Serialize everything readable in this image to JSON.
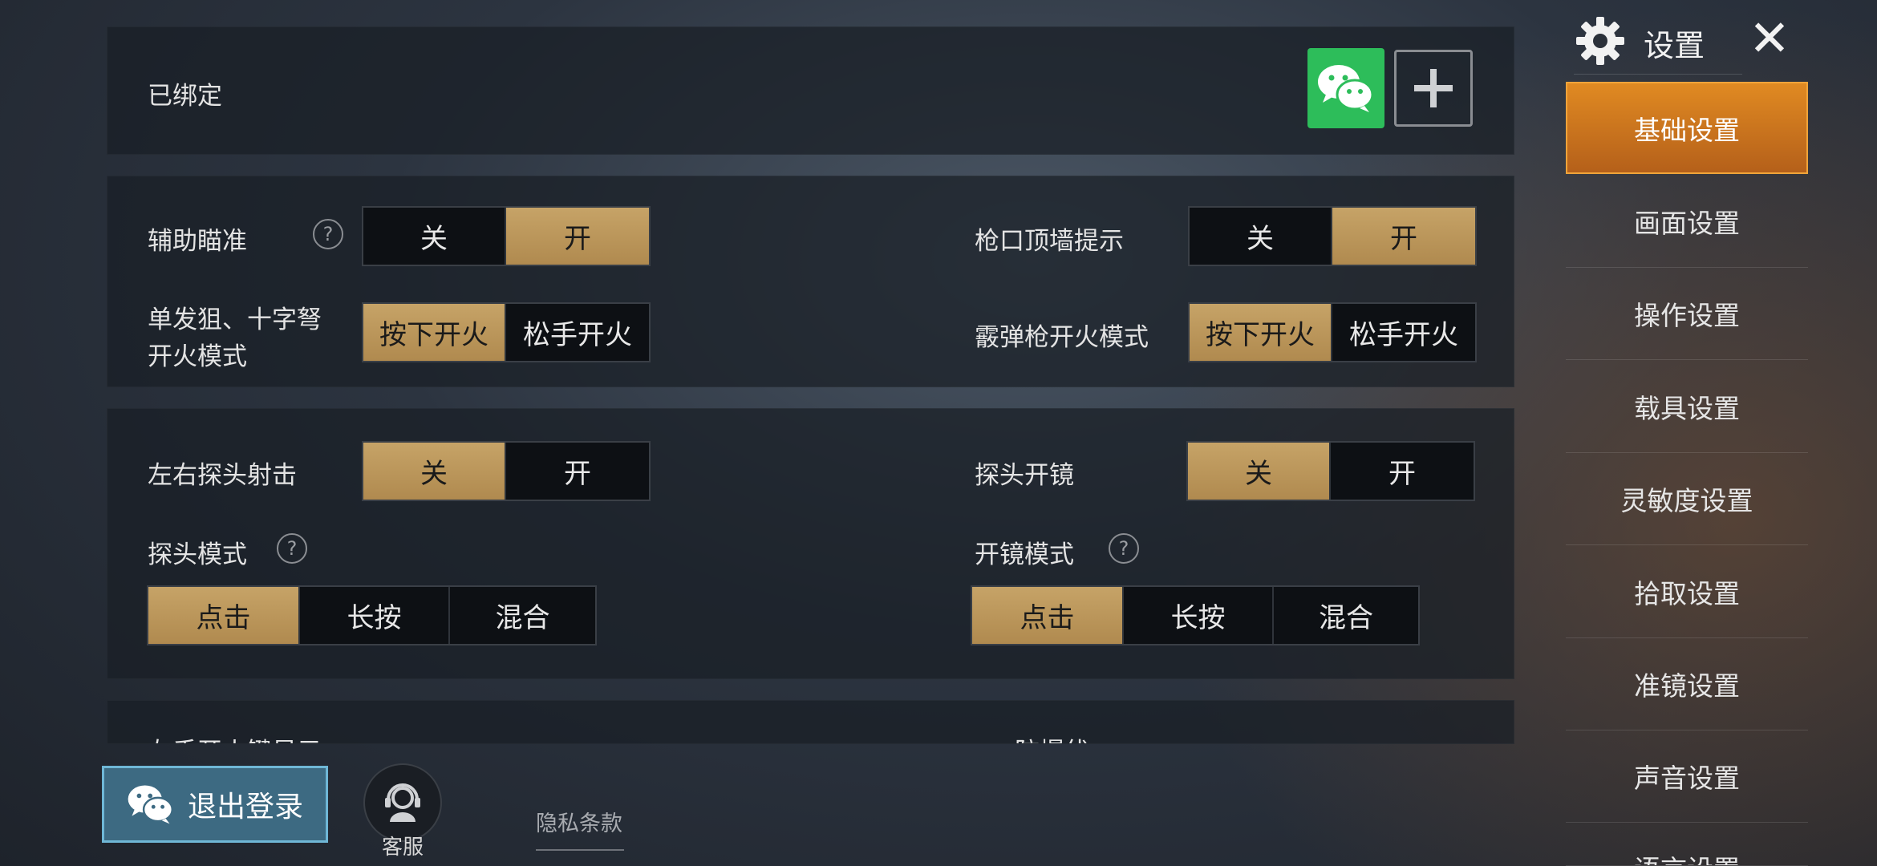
{
  "binding": {
    "label": "已绑定"
  },
  "settings": {
    "aim_assist": {
      "label": "辅助瞄准",
      "options": [
        "关",
        "开"
      ],
      "selected": 1
    },
    "muzzle_wall": {
      "label": "枪口顶墙提示",
      "options": [
        "关",
        "开"
      ],
      "selected": 1
    },
    "sniper_fire": {
      "label_line1": "单发狙、十字弩",
      "label_line2": "开火模式",
      "options": [
        "按下开火",
        "松手开火"
      ],
      "selected": 0
    },
    "shotgun_fire": {
      "label": "霰弹枪开火模式",
      "options": [
        "按下开火",
        "松手开火"
      ],
      "selected": 0
    },
    "peek_shoot": {
      "label": "左右探头射击",
      "options": [
        "关",
        "开"
      ],
      "selected": 0
    },
    "peek_scope": {
      "label": "探头开镜",
      "options": [
        "关",
        "开"
      ],
      "selected": 0
    },
    "peek_mode": {
      "label": "探头模式",
      "options": [
        "点击",
        "长按",
        "混合"
      ],
      "selected": 0
    },
    "scope_mode": {
      "label": "开镜模式",
      "options": [
        "点击",
        "长按",
        "混合"
      ],
      "selected": 0
    },
    "partial_left": "左手开火键显示",
    "partial_right": "防爆伏"
  },
  "help_glyph": "?",
  "bottom": {
    "logout_label": "退出登录",
    "support_label": "客服",
    "privacy_label": "隐私条款"
  },
  "sidebar": {
    "title": "设置",
    "close_glyph": "✕",
    "items": [
      {
        "label": "基础设置"
      },
      {
        "label": "画面设置"
      },
      {
        "label": "操作设置"
      },
      {
        "label": "载具设置"
      },
      {
        "label": "灵敏度设置"
      },
      {
        "label": "拾取设置"
      },
      {
        "label": "准镜设置"
      },
      {
        "label": "声音设置"
      },
      {
        "label": "语言设置"
      }
    ]
  },
  "colors": {
    "accent_orange": "#e08a22",
    "toggle_active": "#c6a367",
    "wechat_green": "#2dbd5a"
  }
}
